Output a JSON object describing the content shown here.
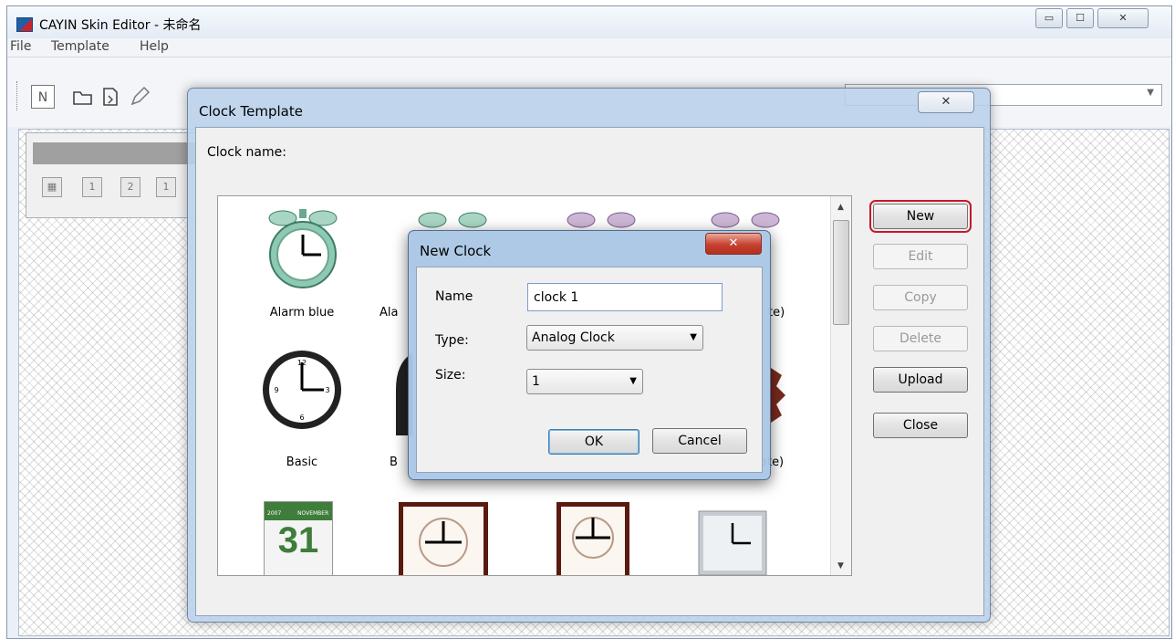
{
  "window": {
    "title": "CAYIN Skin Editor - 未命名",
    "caption_buttons": [
      "▭",
      "☐",
      "✕"
    ]
  },
  "menu": [
    "File",
    "Template",
    "Help"
  ],
  "toolbar": {
    "new_label": "N",
    "side_panel_icons": [
      "▦",
      "1",
      "2",
      "1"
    ]
  },
  "clock_template": {
    "title": "Clock Template",
    "close_label": "✕",
    "clock_name_label": "Clock name:",
    "clocks": [
      {
        "caption": "Alarm blue",
        "icon": "alarm-clock-blue"
      },
      {
        "caption": "Ala",
        "icon": "alarm-clock"
      },
      {
        "caption": "",
        "icon": "alarm-clock-purple"
      },
      {
        "caption": "te)",
        "icon": "alarm-clock-purple"
      },
      {
        "caption": "Basic",
        "icon": "basic-wall-clock"
      },
      {
        "caption": "B",
        "icon": "black-clock"
      },
      {
        "caption": "",
        "icon": "clock"
      },
      {
        "caption": "ate)",
        "icon": "red-clock"
      },
      {
        "caption": "",
        "icon": "calendar-clock",
        "calendar": {
          "year": "2007",
          "month": "NOVEMBER",
          "day": "31"
        }
      },
      {
        "caption": "",
        "icon": "framed-clock-brown"
      },
      {
        "caption": "",
        "icon": "framed-clock-brown-2"
      },
      {
        "caption": "",
        "icon": "silver-clock"
      }
    ],
    "buttons": {
      "new": "New",
      "edit": "Edit",
      "copy": "Copy",
      "delete": "Delete",
      "upload": "Upload",
      "close": "Close"
    }
  },
  "new_clock": {
    "title": "New Clock",
    "close_label": "✕",
    "name_label": "Name",
    "name_value": "clock 1",
    "type_label": "Type:",
    "type_value": "Analog Clock",
    "size_label": "Size:",
    "size_value": "1",
    "ok": "OK",
    "cancel": "Cancel"
  },
  "colors": {
    "highlight_border": "#c8182a",
    "dialog_frame": "#b9d1ea",
    "close_red": "#c6402f"
  }
}
